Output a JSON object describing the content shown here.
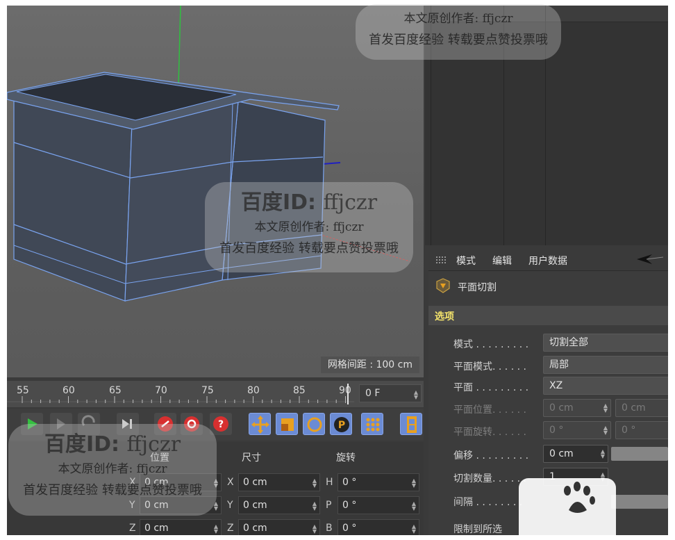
{
  "viewport": {
    "grid_spacing": "网格间距 : 100 cm"
  },
  "attributes": {
    "menu": [
      "模式",
      "编辑",
      "用户数据"
    ],
    "object_title": "平面切割",
    "section": "选项",
    "props": {
      "mode": {
        "label": "模式 . . . . . . . . .",
        "value": "切割全部"
      },
      "plane_mode": {
        "label": "平面模式. . . . . .",
        "value": "局部"
      },
      "plane": {
        "label": "平面 . . . . . . . . .",
        "value": "XZ"
      },
      "plane_pos": {
        "label": "平面位置. . . . . .",
        "v1": "0 cm",
        "v2": "0 cm"
      },
      "plane_rot": {
        "label": "平面旋转. . . . . .",
        "v1": "0 °",
        "v2": "0 °"
      },
      "offset": {
        "label": "偏移 . . . . . . . . .",
        "value": "0 cm"
      },
      "cut_count": {
        "label": "切割数量. . . . . .",
        "value": "1"
      },
      "spacing": {
        "label": "间隔 . . . . . . . ."
      },
      "limit": {
        "label": "限制到所选"
      }
    }
  },
  "timeline": {
    "ticks": [
      "55",
      "60",
      "65",
      "70",
      "75",
      "80",
      "85",
      "90"
    ],
    "frame": "0 F"
  },
  "coords": {
    "headers": {
      "position": "位置",
      "size": "尺寸",
      "rotation": "旋转"
    },
    "rows": [
      {
        "pos_axis": "X",
        "pos": "0 cm",
        "size_axis": "X",
        "size": "0 cm",
        "rot_axis": "H",
        "rot": "0 °"
      },
      {
        "pos_axis": "Y",
        "pos": "0 cm",
        "size_axis": "Y",
        "size": "0 cm",
        "rot_axis": "P",
        "rot": "0 °"
      },
      {
        "pos_axis": "Z",
        "pos": "0 cm",
        "size_axis": "Z",
        "size": "0 cm",
        "rot_axis": "B",
        "rot": "0 °"
      }
    ]
  },
  "watermark": {
    "id_prefix": "百度ID:",
    "id_value": "ffjczr",
    "line1": "本文原创作者: ffjczr",
    "line2": "首发百度经验 转载要点赞投票哦"
  },
  "colors": {
    "accent_blue": "#6b8bd4",
    "section_yellow": "#f3e36b",
    "wire": "#7aa4f0"
  }
}
